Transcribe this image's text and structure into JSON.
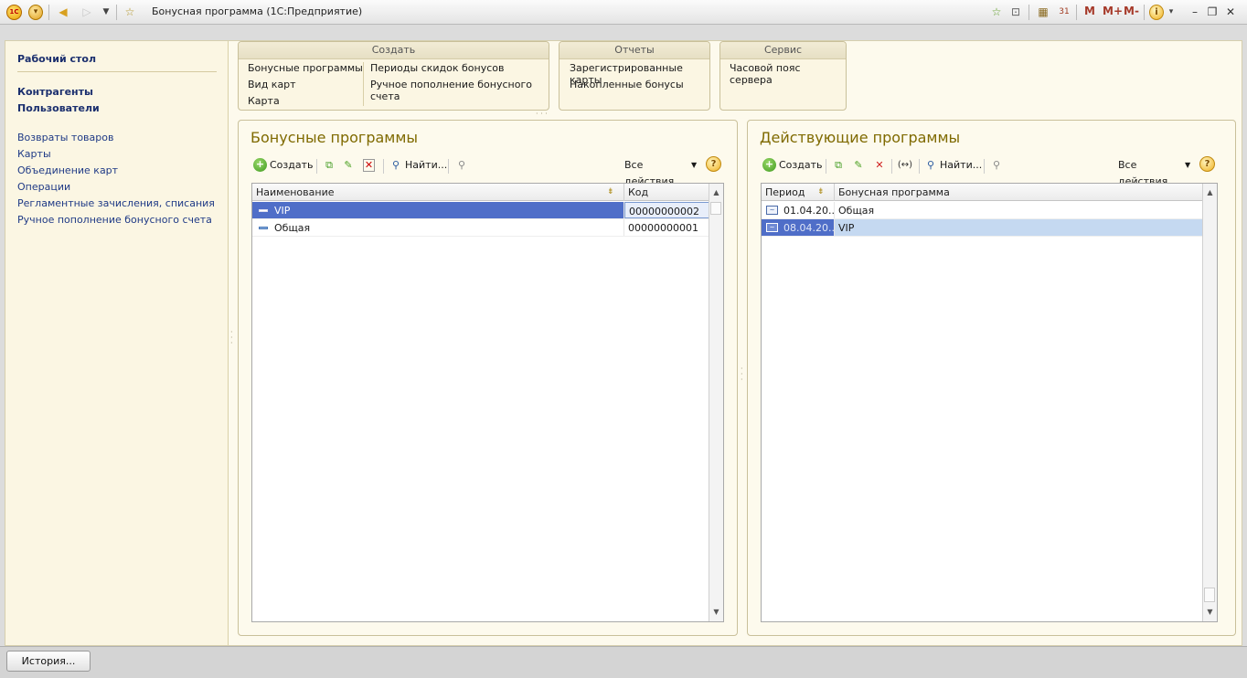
{
  "window": {
    "title": "Бонусная программа  (1С:Предприятие)",
    "logo_text": "1С",
    "memory_buttons": [
      "M",
      "M+",
      "M-"
    ]
  },
  "sidebar": {
    "desktop": "Рабочий стол",
    "main_links": [
      "Контрагенты",
      "Пользователи"
    ],
    "links": [
      "Возвраты товаров",
      "Карты",
      "Объединение карт",
      "Операции",
      "Регламентные зачисления, списания",
      "Ручное пополнение бонусного счета"
    ]
  },
  "groups": {
    "create": {
      "header": "Создать",
      "col1": [
        "Бонусные программы",
        "Вид карт",
        "Карта"
      ],
      "col2": [
        "Периоды скидок бонусов",
        "Ручное пополнение бонусного счета"
      ]
    },
    "reports": {
      "header": "Отчеты",
      "items": [
        "Зарегистрированные карты",
        "Накопленные бонусы"
      ]
    },
    "service": {
      "header": "Сервис",
      "items": [
        "Часовой пояс сервера"
      ]
    }
  },
  "left_panel": {
    "title": "Бонусные программы",
    "create_label": "Создать",
    "find_label": "Найти...",
    "all_actions": "Все действия",
    "help": "?",
    "columns": [
      "Наименование",
      "Код"
    ],
    "rows": [
      {
        "name": "VIP",
        "code": "00000000002"
      },
      {
        "name": "Общая",
        "code": "00000000001"
      }
    ]
  },
  "right_panel": {
    "title": "Действующие программы",
    "create_label": "Создать",
    "find_label": "Найти...",
    "all_actions": "Все действия",
    "help": "?",
    "columns": [
      "Период",
      "Бонусная программа"
    ],
    "rows": [
      {
        "period": "01.04.20...",
        "program": "Общая"
      },
      {
        "period": "08.04.20...",
        "program": "VIP"
      }
    ]
  },
  "footer": {
    "history_button": "История..."
  },
  "colors": {
    "accent_title": "#7f6a00",
    "selected_row_left": "#4f6ec8",
    "selected_row_right": "#c5d9f1",
    "workspace_bg": "#fdfaed",
    "link": "#1f3a86"
  }
}
